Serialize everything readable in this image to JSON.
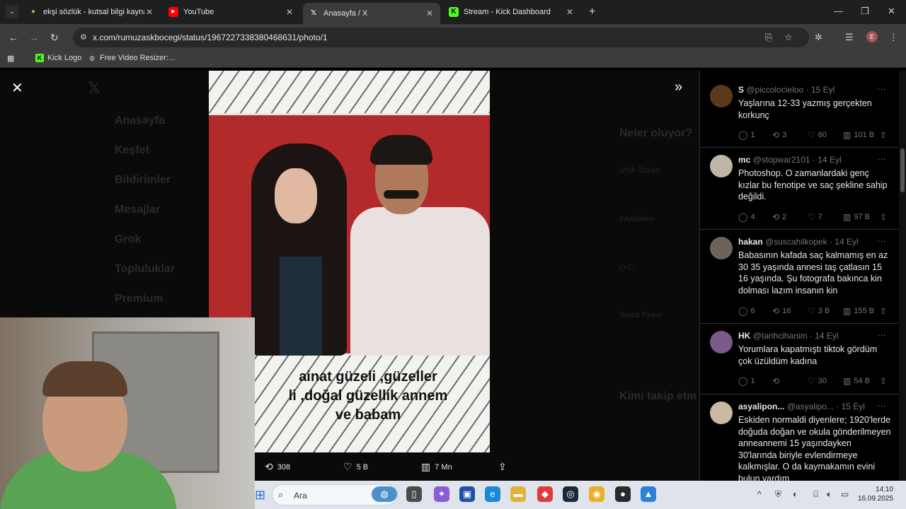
{
  "browser": {
    "tabs": [
      {
        "title": "ekşi sözlük - kutsal bilgi kaynağı",
        "favicon": "leaf-icon",
        "color": "#81c14b"
      },
      {
        "title": "YouTube",
        "favicon": "youtube-icon",
        "color": "#ff0000"
      },
      {
        "title": "Anasayfa / X",
        "favicon": "x-icon",
        "color": "#ffffff"
      },
      {
        "title": "Stream - Kick Dashboard",
        "favicon": "kick-icon",
        "color": "#53fc18"
      }
    ],
    "url": "x.com/rumuzaskbocegi/status/1967227338380468631/photo/1",
    "profile_initial": "E",
    "bookmarks": [
      {
        "label": "Kick Logo",
        "icon": "kick-icon"
      },
      {
        "label": "Free Video Resizer:...",
        "icon": "globe-icon"
      }
    ]
  },
  "background_nav": [
    "Anasayfa",
    "Keşfet",
    "Bildirimler",
    "Mesajlar",
    "Grok",
    "Topluluklar",
    "Premium"
  ],
  "background_right": {
    "title": "Neler oluyor?",
    "items": [
      "Ufuk Özkan",
      "#Asbeden",
      "O.C.",
      "Sedat Peker"
    ],
    "who_to_follow": "Kimi takip etm"
  },
  "photo": {
    "caption_lines": [
      "ainat güzeli ,güzeller",
      "li ,doğal güzellik annem",
      "ve babam"
    ]
  },
  "actions": {
    "retweets": "308",
    "likes": "5 B",
    "views": "7 Mn"
  },
  "replies": [
    {
      "name": "S",
      "handle": "@piccolocieloo",
      "date": "15 Eyl",
      "text": "Yaşlarına 12-33 yazmış gerçekten korkunç",
      "reply": "1",
      "retweet": "3",
      "like": "60",
      "views": "101 B",
      "avatar_color": "#5a3a1a"
    },
    {
      "name": "mc",
      "handle": "@stopwar2101",
      "date": "14 Eyl",
      "text": "Photoshop. O zamanlardaki genç kızlar bu fenotipe ve saç şekline sahip değildi.",
      "reply": "4",
      "retweet": "2",
      "like": "7",
      "views": "97 B",
      "avatar_color": "#bfb6a8"
    },
    {
      "name": "hakan",
      "handle": "@suscahilkopek",
      "date": "14 Eyl",
      "text": "Babasının kafada saç kalmamış en az 30 35 yaşında annesi taş çatlasın 15 16 yaşında. Şu fotografa bakınca kin dolması lazım insanın kin",
      "reply": "6",
      "retweet": "16",
      "like": "3 B",
      "views": "155 B",
      "avatar_color": "#6d6459"
    },
    {
      "name": "HK",
      "handle": "@tarihcihanim",
      "date": "14 Eyl",
      "text": "Yorumlara kapatmıştı tiktok gördüm çok üzüldüm kadına",
      "reply": "1",
      "retweet": "",
      "like": "30",
      "views": "54 B",
      "avatar_color": "#7a5a8a"
    },
    {
      "name": "asyalipon...",
      "handle": "@asyalipo...",
      "date": "15 Eyl",
      "text": "Eskiden normaldi diyenlere; 1920'lerde doğuda doğan ve okula gönderilmeyen anneannemi 15 yaşındayken 30'larında biriyle evlendirmeye kalkmışlar. O da kaymakamın evini bulun yardım",
      "reply": "",
      "retweet": "",
      "like": "",
      "views": "",
      "avatar_color": "#c9b9a0"
    }
  ],
  "taskbar": {
    "search_label": "Ara",
    "time": "14:10",
    "date": "16.09.2025"
  }
}
